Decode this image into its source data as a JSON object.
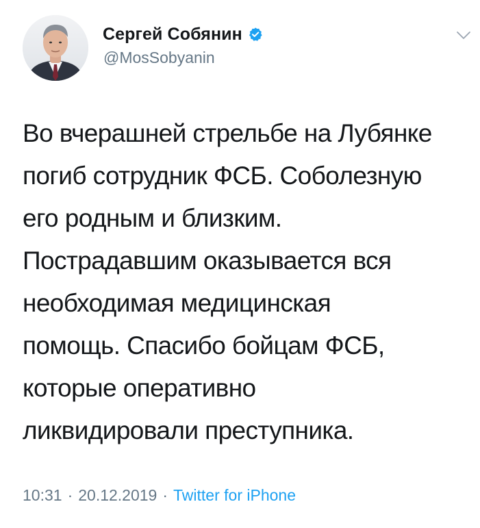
{
  "tweet": {
    "author": {
      "display_name": "Сергей Собянин",
      "handle": "@MosSobyanin",
      "verified": true,
      "avatar_icon": "user-photo-avatar"
    },
    "more_icon": "chevron-down-icon",
    "text_lines": [
      "Во вчерашней стрельбе на Лубянке",
      "погиб сотрудник ФСБ. Соболезную",
      "его родным и близким.",
      "Пострадавшим оказывается вся",
      "необходимая медицинская",
      "помощь. Спасибо бойцам ФСБ,",
      "которые оперативно",
      "ликвидировали преступника."
    ],
    "time": "10:31",
    "separator": "·",
    "date": "20.12.2019",
    "source": "Twitter for iPhone"
  },
  "colors": {
    "text": "#14171a",
    "secondary": "#657786",
    "link": "#1da1f2",
    "verified": "#1da1f2"
  }
}
